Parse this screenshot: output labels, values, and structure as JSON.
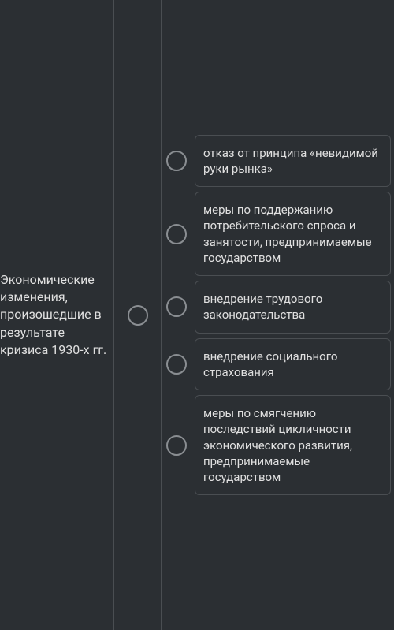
{
  "question": {
    "prompt": "Экономические изменения, произошедшие в результате кризиса 1930-х гг."
  },
  "options": [
    {
      "label": "отказ от принципа «невидимой руки рынка»"
    },
    {
      "label": "меры по поддержанию потребительского спроса и занятости, предпринимаемые государством"
    },
    {
      "label": "внедрение трудового законодательства"
    },
    {
      "label": "внедрение социального страхования"
    },
    {
      "label": "меры по смягчению последствий цикличности экономического развития, предпринимаемые государством"
    }
  ]
}
